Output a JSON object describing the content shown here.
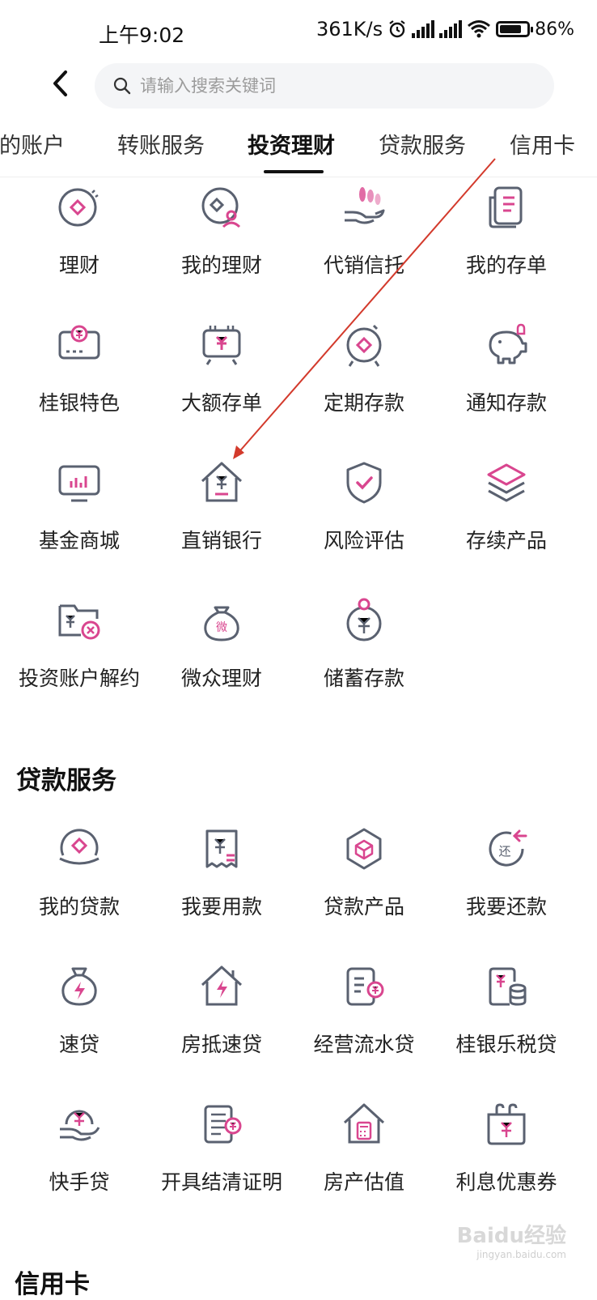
{
  "status_bar": {
    "time": "上午9:02",
    "speed": "361K/s",
    "battery": "86%"
  },
  "search": {
    "placeholder": "请输入搜索关键词"
  },
  "tabs": [
    {
      "label": "我的账户"
    },
    {
      "label": "转账服务"
    },
    {
      "label": "投资理财"
    },
    {
      "label": "贷款服务"
    },
    {
      "label": "信用卡"
    }
  ],
  "invest": {
    "items": [
      {
        "label": "理财",
        "icon": "coin-diamond-icon"
      },
      {
        "label": "我的理财",
        "icon": "user-coin-icon"
      },
      {
        "label": "代销信托",
        "icon": "hand-coins-icon"
      },
      {
        "label": "我的存单",
        "icon": "document-icon"
      },
      {
        "label": "桂银特色",
        "icon": "yuan-card-icon"
      },
      {
        "label": "大额存单",
        "icon": "yuan-device-icon"
      },
      {
        "label": "定期存款",
        "icon": "clock-diamond-icon"
      },
      {
        "label": "通知存款",
        "icon": "piggy-bell-icon"
      },
      {
        "label": "基金商城",
        "icon": "monitor-chart-icon"
      },
      {
        "label": "直销银行",
        "icon": "house-yuan-icon"
      },
      {
        "label": "风险评估",
        "icon": "shield-check-icon"
      },
      {
        "label": "存续产品",
        "icon": "layers-icon"
      },
      {
        "label": "投资账户解约",
        "icon": "folder-cancel-icon"
      },
      {
        "label": "微众理财",
        "icon": "money-bag-icon"
      },
      {
        "label": "储蓄存款",
        "icon": "yuan-coin-icon"
      }
    ]
  },
  "loan": {
    "title": "贷款服务",
    "items": [
      {
        "label": "我的贷款",
        "icon": "loan-diamond-icon"
      },
      {
        "label": "我要用款",
        "icon": "receipt-yuan-icon"
      },
      {
        "label": "贷款产品",
        "icon": "hexagon-box-icon"
      },
      {
        "label": "我要还款",
        "icon": "repay-icon"
      },
      {
        "label": "速贷",
        "icon": "bag-lightning-icon"
      },
      {
        "label": "房抵速贷",
        "icon": "house-lightning-icon"
      },
      {
        "label": "经营流水贷",
        "icon": "doc-coin-icon"
      },
      {
        "label": "桂银乐税贷",
        "icon": "doc-database-icon"
      },
      {
        "label": "快手贷",
        "icon": "hand-yuan-icon"
      },
      {
        "label": "开具结清证明",
        "icon": "certificate-icon"
      },
      {
        "label": "房产估值",
        "icon": "house-calculator-icon"
      },
      {
        "label": "利息优惠券",
        "icon": "coupon-icon"
      }
    ]
  },
  "next_section_partial": "信用卡",
  "watermark": {
    "text": "Baidu经验",
    "sub": "jingyan.baidu.com"
  },
  "colors": {
    "accent": "#d9468f",
    "icon_stroke": "#5a6170"
  }
}
